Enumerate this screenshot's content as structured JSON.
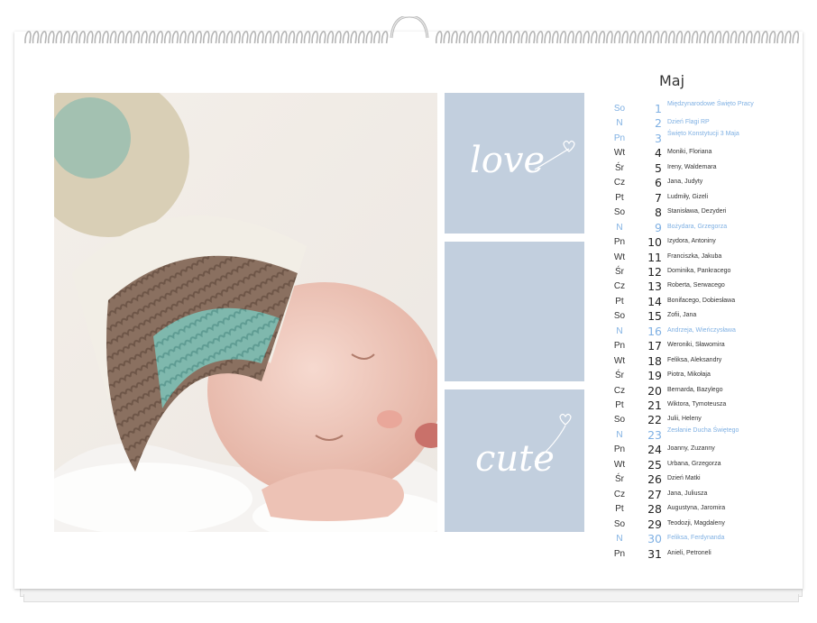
{
  "calendar": {
    "month": "Maj",
    "days": [
      {
        "weekday": "So",
        "day": "1",
        "names": "Międzynarodowe Święto Pracy",
        "holiday": true
      },
      {
        "weekday": "N",
        "day": "2",
        "names": "Dzień Flagi RP",
        "holiday": true
      },
      {
        "weekday": "Pn",
        "day": "3",
        "names": "Święto Konstytucji 3 Maja",
        "holiday": true
      },
      {
        "weekday": "Wt",
        "day": "4",
        "names": "Moniki, Floriana",
        "holiday": false
      },
      {
        "weekday": "Śr",
        "day": "5",
        "names": "Ireny, Waldemara",
        "holiday": false
      },
      {
        "weekday": "Cz",
        "day": "6",
        "names": "Jana, Judyty",
        "holiday": false
      },
      {
        "weekday": "Pt",
        "day": "7",
        "names": "Ludmiły, Gizeli",
        "holiday": false
      },
      {
        "weekday": "So",
        "day": "8",
        "names": "Stanisława, Dezyderi",
        "holiday": false
      },
      {
        "weekday": "N",
        "day": "9",
        "names": "Bożydara, Grzegorza",
        "holiday": true
      },
      {
        "weekday": "Pn",
        "day": "10",
        "names": "Izydora, Antoniny",
        "holiday": false
      },
      {
        "weekday": "Wt",
        "day": "11",
        "names": "Franciszka, Jakuba",
        "holiday": false
      },
      {
        "weekday": "Śr",
        "day": "12",
        "names": "Dominika, Pankracego",
        "holiday": false
      },
      {
        "weekday": "Cz",
        "day": "13",
        "names": "Roberta, Serwacego",
        "holiday": false
      },
      {
        "weekday": "Pt",
        "day": "14",
        "names": "Bonifacego, Dobiesława",
        "holiday": false
      },
      {
        "weekday": "So",
        "day": "15",
        "names": "Zofii, Jana",
        "holiday": false
      },
      {
        "weekday": "N",
        "day": "16",
        "names": "Andrzeja, Wieńczysława",
        "holiday": true
      },
      {
        "weekday": "Pn",
        "day": "17",
        "names": "Weroniki, Sławomira",
        "holiday": false
      },
      {
        "weekday": "Wt",
        "day": "18",
        "names": "Feliksa, Aleksandry",
        "holiday": false
      },
      {
        "weekday": "Śr",
        "day": "19",
        "names": "Piotra, Mikołaja",
        "holiday": false
      },
      {
        "weekday": "Cz",
        "day": "20",
        "names": "Bernarda, Bazylego",
        "holiday": false
      },
      {
        "weekday": "Pt",
        "day": "21",
        "names": "Wiktora, Tymoteusza",
        "holiday": false
      },
      {
        "weekday": "So",
        "day": "22",
        "names": "Julii, Heleny",
        "holiday": false
      },
      {
        "weekday": "N",
        "day": "23",
        "names": "Zesłanie Ducha Świętego",
        "holiday": true
      },
      {
        "weekday": "Pn",
        "day": "24",
        "names": "Joanny, Zuzanny",
        "holiday": false
      },
      {
        "weekday": "Wt",
        "day": "25",
        "names": "Urbana, Grzegorza",
        "holiday": false
      },
      {
        "weekday": "Śr",
        "day": "26",
        "names": "Dzień Matki",
        "holiday": false
      },
      {
        "weekday": "Cz",
        "day": "27",
        "names": "Jana, Juliusza",
        "holiday": false
      },
      {
        "weekday": "Pt",
        "day": "28",
        "names": "Augustyna, Jaromira",
        "holiday": false
      },
      {
        "weekday": "So",
        "day": "29",
        "names": "Teodozji, Magdaleny",
        "holiday": false
      },
      {
        "weekday": "N",
        "day": "30",
        "names": "Feliksa, Ferdynanda",
        "holiday": true
      },
      {
        "weekday": "Pn",
        "day": "31",
        "names": "Anieli, Petroneli",
        "holiday": false
      }
    ]
  },
  "tiles": {
    "top_word": "love",
    "bottom_word": "cute"
  },
  "colors": {
    "tile_blue": "#c2cfde",
    "holiday_blue": "#7fb0e3",
    "hat_brown": "#8a7060",
    "hat_teal": "#7fb8ad"
  }
}
